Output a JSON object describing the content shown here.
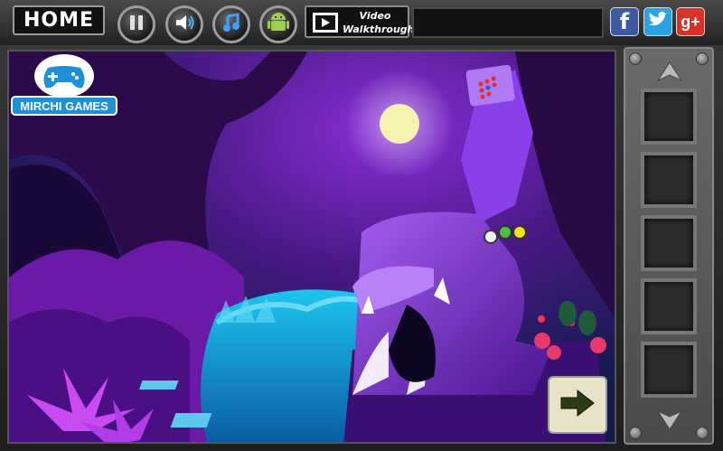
{
  "toolbar": {
    "home_label": "HOME",
    "video_label_line1": "Video",
    "video_label_line2": "Walkthrough"
  },
  "social": {
    "facebook": "f",
    "twitter": "t",
    "googleplus": "g+"
  },
  "logo": {
    "text": "MIRCHI GAMES"
  },
  "icons": {
    "pause": "pause-icon",
    "sound": "speaker-icon",
    "music": "music-note-icon",
    "android": "android-icon",
    "video": "film-icon",
    "next": "arrow-right-icon",
    "inv_up": "arrow-up-icon",
    "inv_down": "arrow-down-icon"
  },
  "inventory": {
    "slots": [
      "",
      "",
      "",
      "",
      ""
    ]
  },
  "colors": {
    "sky": "#5a1a9a",
    "moon": "#f6f2b0",
    "water": "#17b6e6",
    "statue": "#7a2fd6",
    "foliage": "#8d2ed0"
  }
}
